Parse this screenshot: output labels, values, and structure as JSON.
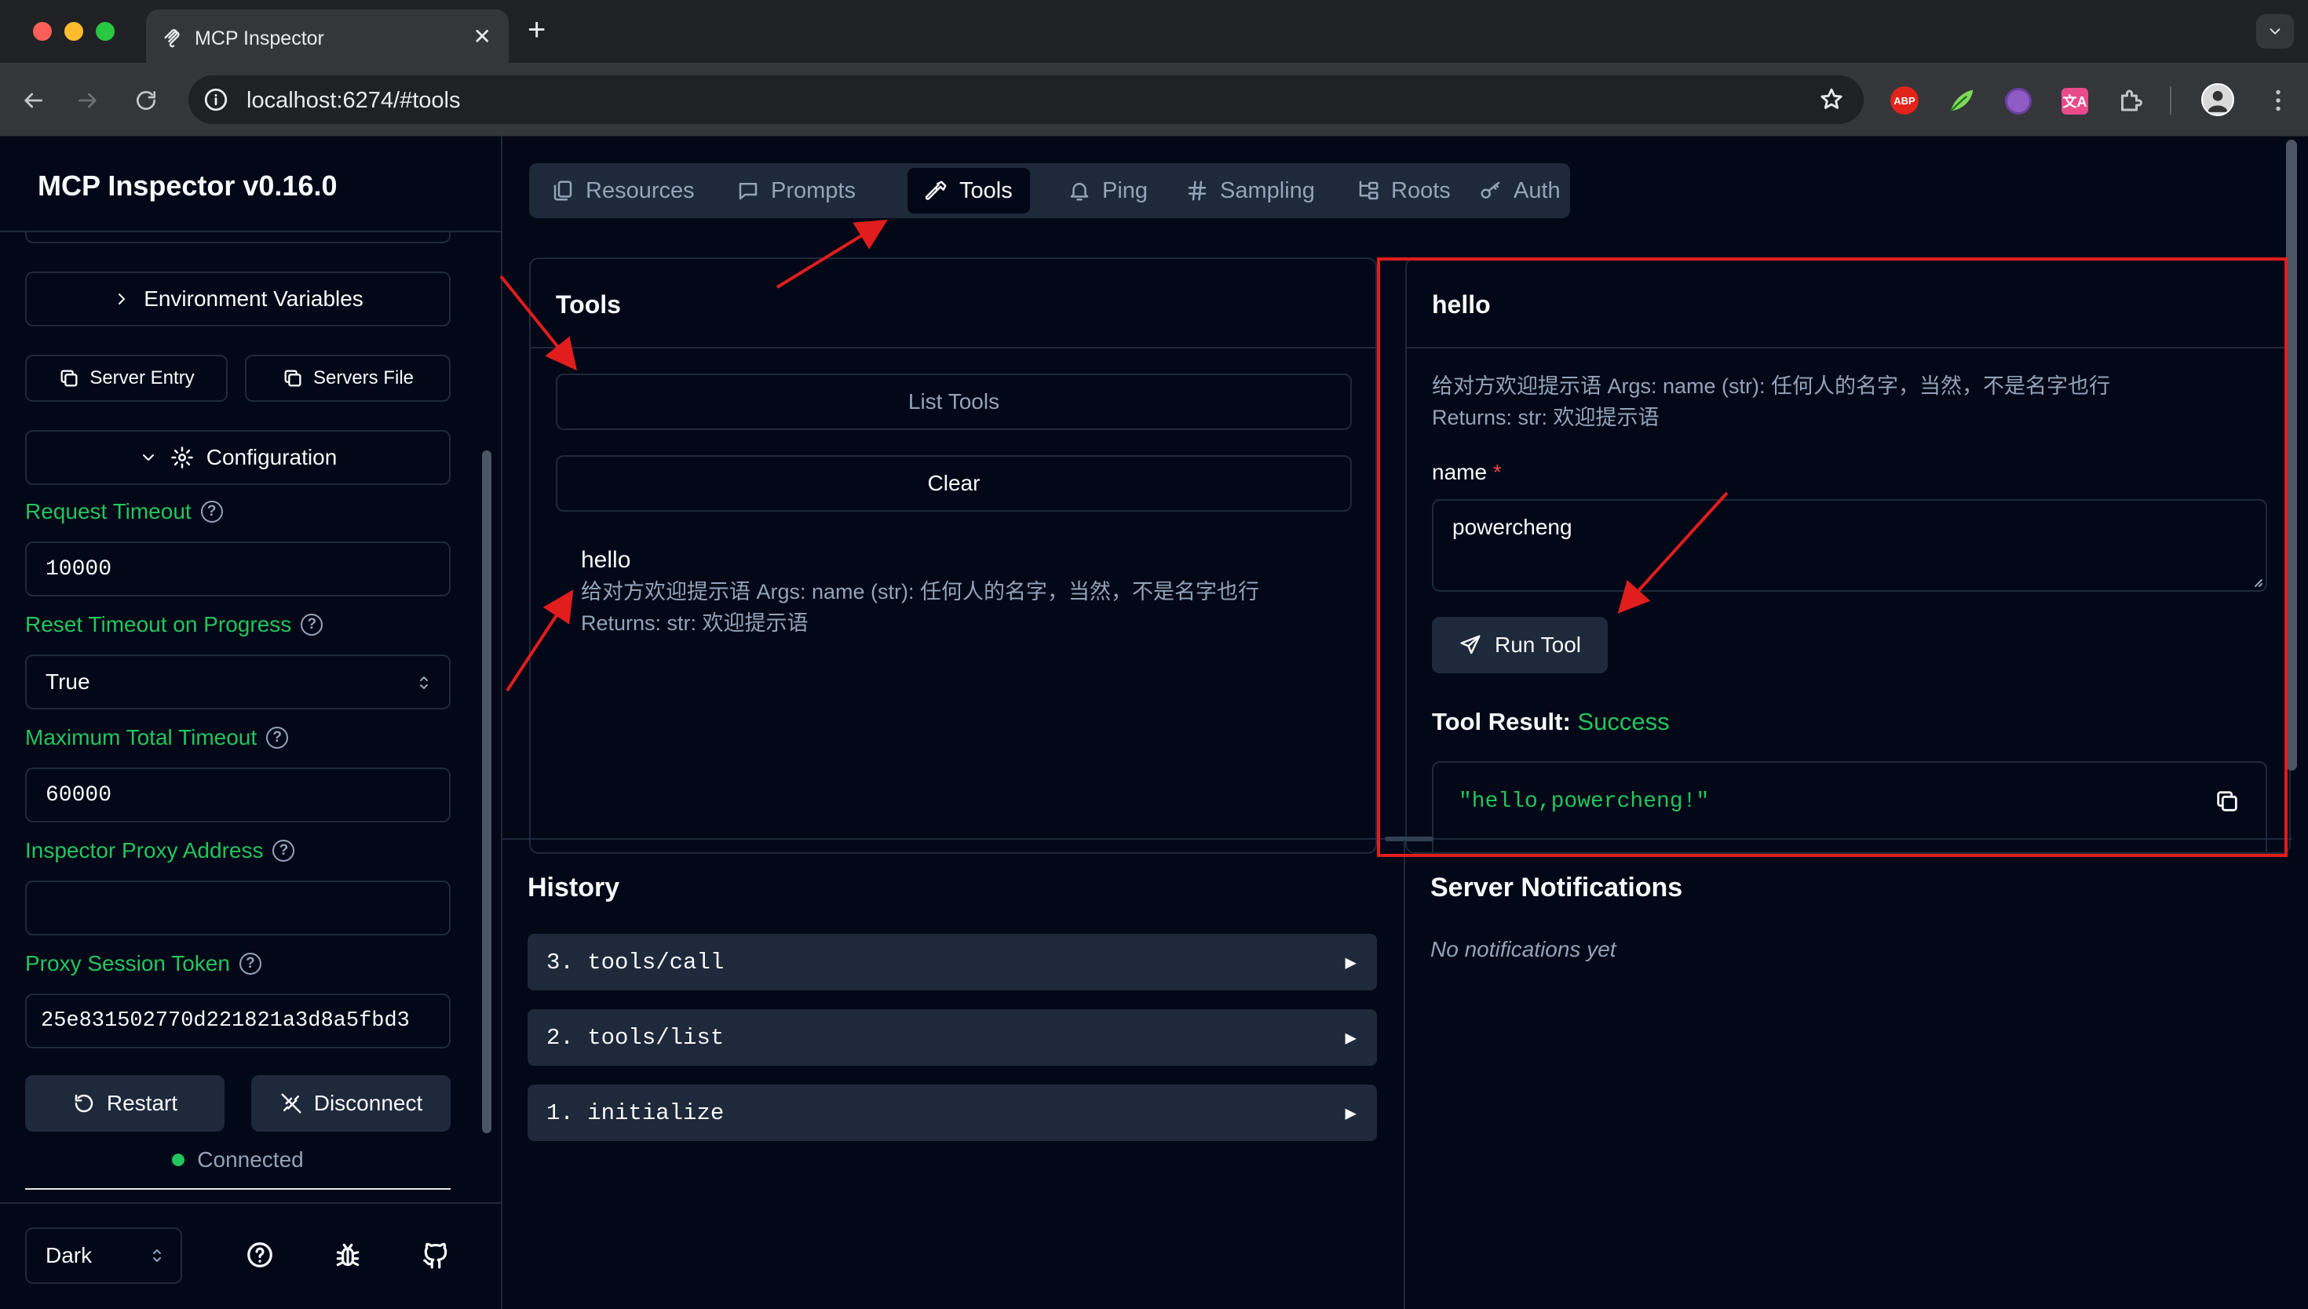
{
  "browser": {
    "tab_title": "MCP Inspector",
    "new_tab": "+",
    "url": "localhost:6274/#tools",
    "extensions": [
      "ABP",
      "leaf",
      "grape",
      "translate"
    ],
    "colors": {
      "traffic_red": "#ff5f57",
      "traffic_yellow": "#febc2e",
      "traffic_green": "#28c840"
    }
  },
  "sidebar": {
    "app_title": "MCP Inspector v0.16.0",
    "env_vars_label": "Environment Variables",
    "server_entry_label": "Server Entry",
    "servers_file_label": "Servers File",
    "configuration_label": "Configuration",
    "request_timeout": {
      "label": "Request Timeout",
      "value": "10000"
    },
    "reset_timeout": {
      "label": "Reset Timeout on Progress",
      "value": "True"
    },
    "max_total_timeout": {
      "label": "Maximum Total Timeout",
      "value": "60000"
    },
    "proxy_address": {
      "label": "Inspector Proxy Address",
      "value": ""
    },
    "proxy_token": {
      "label": "Proxy Session Token",
      "value": "25e831502770d221821a3d8a5fbd3"
    },
    "restart_label": "Restart",
    "disconnect_label": "Disconnect",
    "status": "Connected",
    "theme": "Dark",
    "colors": {
      "label_green": "#22c55e",
      "status_dot": "#22c55e"
    }
  },
  "main": {
    "tabs": [
      {
        "label": "Resources",
        "icon": "files-icon"
      },
      {
        "label": "Prompts",
        "icon": "message-icon"
      },
      {
        "label": "Tools",
        "icon": "hammer-icon",
        "active": true
      },
      {
        "label": "Ping",
        "icon": "bell-icon"
      },
      {
        "label": "Sampling",
        "icon": "hash-icon"
      },
      {
        "label": "Roots",
        "icon": "folder-tree-icon"
      },
      {
        "label": "Auth",
        "icon": "key-icon"
      }
    ],
    "tools_panel": {
      "title": "Tools",
      "list_tools_label": "List Tools",
      "clear_label": "Clear",
      "tool": {
        "name": "hello",
        "desc_line1": "给对方欢迎提示语 Args: name (str): 任何人的名字，当然，不是名字也行",
        "desc_line2": "Returns: str: 欢迎提示语"
      }
    },
    "detail_panel": {
      "title": "hello",
      "desc_line1": "给对方欢迎提示语 Args: name (str): 任何人的名字，当然，不是名字也行",
      "desc_line2": "Returns: str: 欢迎提示语",
      "field_label": "name",
      "required_mark": "*",
      "field_value": "powercheng",
      "run_label": "Run Tool",
      "result_label": "Tool Result:",
      "result_status": "Success",
      "result_value": "\"hello,powercheng!\""
    },
    "history": {
      "title": "History",
      "items": [
        {
          "index": "3.",
          "method": "tools/call"
        },
        {
          "index": "2.",
          "method": "tools/list"
        },
        {
          "index": "1.",
          "method": "initialize"
        }
      ],
      "expand_glyph": "▶"
    },
    "notifications": {
      "title": "Server Notifications",
      "empty_text": "No notifications yet"
    },
    "colors": {
      "success": "#22c55e",
      "annotation_red": "#e11d1d",
      "required": "#ef4444"
    }
  }
}
